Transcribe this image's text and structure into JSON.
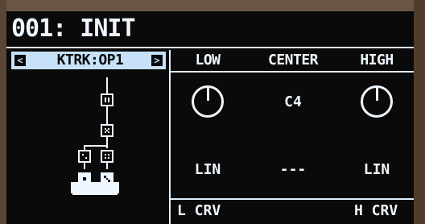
{
  "header": {
    "title": "001: INIT"
  },
  "track_selector": {
    "prev_label": "<",
    "next_label": ">",
    "track_label": "KTRK:OP1"
  },
  "columns": {
    "low": "LOW",
    "center": "CENTER",
    "high": "HIGH"
  },
  "values": {
    "center_note": "C4",
    "low_curve": "LIN",
    "center_curve": "---",
    "high_curve": "LIN"
  },
  "footer": {
    "left_label": "L CRV",
    "right_label": "H CRV"
  },
  "colors": {
    "screen_bg": "#0a0a0a",
    "foreground": "#eef6ff",
    "highlight": "#c7e2f8"
  }
}
